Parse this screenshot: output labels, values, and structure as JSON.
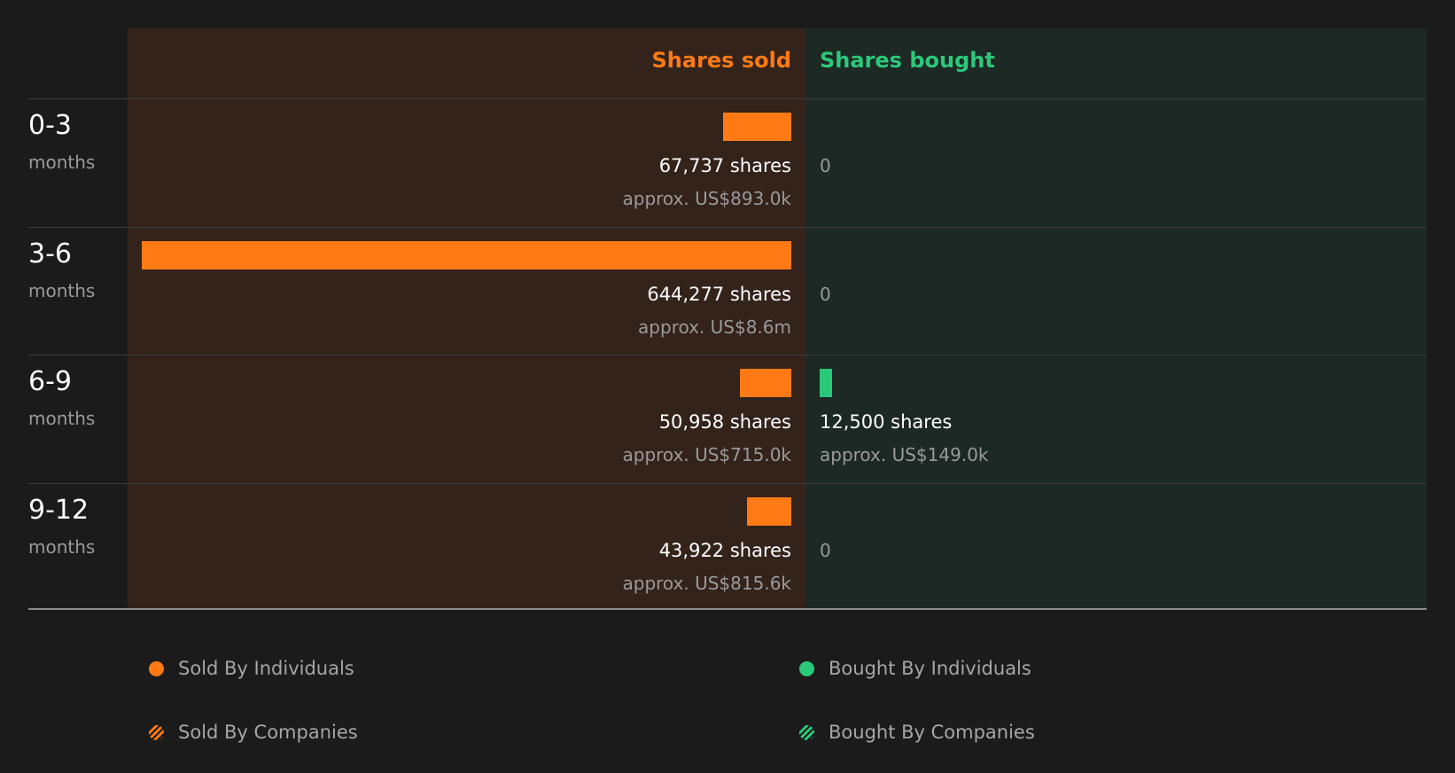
{
  "chart_data": {
    "type": "bar",
    "orientation": "horizontal",
    "categories": [
      {
        "period": "0-3",
        "unit": "months"
      },
      {
        "period": "3-6",
        "unit": "months"
      },
      {
        "period": "6-9",
        "unit": "months"
      },
      {
        "period": "9-12",
        "unit": "months"
      }
    ],
    "series": [
      {
        "name": "Shares sold",
        "values": [
          67737,
          644277,
          50958,
          43922
        ],
        "labels": [
          "67,737 shares",
          "644,277 shares",
          "50,958 shares",
          "43,922 shares"
        ],
        "usd": [
          "approx. US$893.0k",
          "approx. US$8.6m",
          "approx. US$715.0k",
          "approx. US$815.6k"
        ]
      },
      {
        "name": "Shares bought",
        "values": [
          0,
          0,
          12500,
          0
        ],
        "labels": [
          "0",
          "0",
          "12,500 shares",
          "0"
        ],
        "usd": [
          "",
          "",
          "approx. US$149.0k",
          ""
        ]
      }
    ],
    "legend": [
      {
        "label": "Sold By Individuals",
        "color": "#ff7a14",
        "pattern": "solid"
      },
      {
        "label": "Bought By Individuals",
        "color": "#2bc87a",
        "pattern": "solid"
      },
      {
        "label": "Sold By Companies",
        "color": "#ff7a14",
        "pattern": "striped"
      },
      {
        "label": "Bought By Companies",
        "color": "#2bc87a",
        "pattern": "striped"
      }
    ],
    "legend_placement": "bottom",
    "grid": false
  },
  "colors": {
    "sold": "#ff7a14",
    "bought": "#2bc87a",
    "sold_bg": "#33231b",
    "bought_bg": "#1c2925"
  }
}
